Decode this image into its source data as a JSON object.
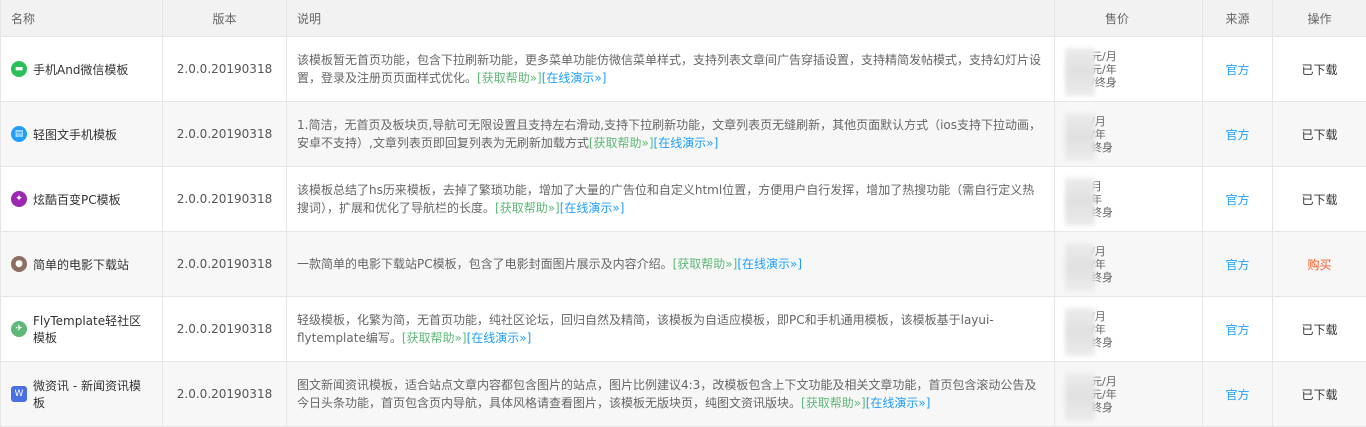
{
  "headers": {
    "name": "名称",
    "version": "版本",
    "desc": "说明",
    "price": "售价",
    "source": "来源",
    "action": "操作"
  },
  "link_help": "[获取帮助»]",
  "link_demo": "[在线演示»]",
  "rows": [
    {
      "name": "手机And微信模板",
      "icon": "wechat-icon",
      "icon_color": "#2bbf5a",
      "version": "2.0.0.20190318",
      "desc": "该模板暂无首页功能，包含下拉刷新功能，更多菜单功能仿微信菜单样式，支持列表文章间广告穿插设置，支持精简发帖模式，支持幻灯片设置，登录及注册页页面样式优化。",
      "price_lines": [
        "元/月",
        "元/年",
        "/终身"
      ],
      "source": "官方",
      "action": "已下载",
      "action_type": "done"
    },
    {
      "name": "轻图文手机模板",
      "icon": "image-text-icon",
      "icon_color": "#1e9fff",
      "version": "2.0.0.20190318",
      "desc": "1.简洁，无首页及板块页,导航可无限设置且支持左右滑动,支持下拉刷新功能，文章列表页无缝刷新，其他页面默认方式（ios支持下拉动画，安卓不支持）,文章列表页即回复列表为无刷新加载方式",
      "price_lines": [
        "/月",
        "/年",
        "终身"
      ],
      "source": "官方",
      "action": "已下载",
      "action_type": "done"
    },
    {
      "name": "炫酷百变PC模板",
      "icon": "cool-icon",
      "icon_color": "#9c27b0",
      "version": "2.0.0.20190318",
      "desc": "该模板总结了hs历来模板，去掉了繁琐功能，增加了大量的广告位和自定义html位置，方便用户自行发挥，增加了热搜功能（需自行定义热搜词），扩展和优化了导航栏的长度。",
      "price_lines": [
        "月",
        "年",
        "终身"
      ],
      "source": "官方",
      "action": "已下载",
      "action_type": "done"
    },
    {
      "name": "简单的电影下载站",
      "icon": "movie-icon",
      "icon_color": "#8d6e63",
      "version": "2.0.0.20190318",
      "desc": "一款简单的电影下载站PC模板，包含了电影封面图片展示及内容介绍。",
      "price_lines": [
        "/月",
        "/年",
        "终身"
      ],
      "source": "官方",
      "action": "购买",
      "action_type": "buy"
    },
    {
      "name": "FlyTemplate轻社区模板",
      "icon": "fly-icon",
      "icon_color": "#5fb878",
      "version": "2.0.0.20190318",
      "desc": "轻级模板，化繁为简，无首页功能，纯社区论坛，回归自然及精简，该模板为自适应模板，即PC和手机通用模板，该模板基于layui-flytemplate编写。",
      "price_lines": [
        "/月",
        "/年",
        "终身"
      ],
      "source": "官方",
      "action": "已下载",
      "action_type": "done"
    },
    {
      "name": "微资讯 - 新闻资讯模板",
      "icon": "news-icon",
      "icon_color": "#4a6fe3",
      "version": "2.0.0.20190318",
      "desc": "图文新闻资讯模板，适合站点文章内容都包含图片的站点，图片比例建议4:3，改模板包含上下文功能及相关文章功能，首页包含滚动公告及今日头条功能，首页包含页内导航，具体风格请查看图片，该模板无版块页，纯图文资讯版块。",
      "price_lines": [
        "元/月",
        "元/年",
        "终身"
      ],
      "source": "官方",
      "action": "已下载",
      "action_type": "done"
    }
  ]
}
